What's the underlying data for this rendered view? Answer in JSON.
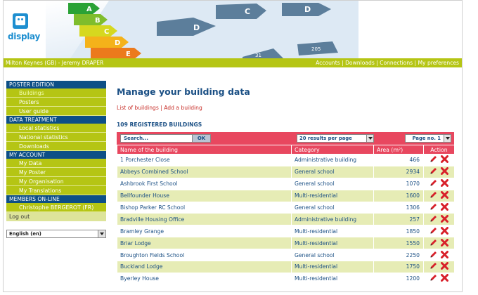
{
  "logo": {
    "word": "display"
  },
  "banner": {
    "scale_letters": [
      "A",
      "B",
      "C",
      "D",
      "E"
    ],
    "rating_tags": [
      "D",
      "C",
      "D"
    ],
    "tag_values": [
      "31",
      "205"
    ]
  },
  "topbar": {
    "user": "Milton Keynes (GB) - Jeremy DRAPER",
    "links": [
      "Accounts",
      "Downloads",
      "Connections",
      "My preferences"
    ],
    "separator": " | "
  },
  "sidebar": {
    "sections": [
      {
        "title": "POSTER EDITION",
        "items": [
          "Buildings",
          "Posters",
          "User guide"
        ]
      },
      {
        "title": "DATA TREATMENT",
        "items": [
          "Local statistics",
          "National statistics",
          "Downloads"
        ]
      },
      {
        "title": "MY ACCOUNT",
        "items": [
          "My Data",
          "My Poster",
          "My Organisation",
          "My Translations"
        ]
      },
      {
        "title": "MEMBERS ON-LINE",
        "items": [
          "Christophe BERGEROT (FR)"
        ]
      }
    ],
    "active_item": "Buildings",
    "logout": "Log out",
    "language": "English (en)"
  },
  "main": {
    "title": "Manage your building data",
    "links": [
      "List of buildings",
      "Add a building"
    ],
    "link_separator": " | ",
    "count": "109 REGISTERED BUILDINGS",
    "search": {
      "placeholder": "Search...",
      "button": "OK"
    },
    "per_page": "20 results per page",
    "page": "Page no. 1",
    "columns": [
      "Name of the building",
      "Category",
      "Area (m²)",
      "Action"
    ],
    "rows": [
      {
        "name": "1 Porchester Close",
        "category": "Administrative building",
        "area": "466"
      },
      {
        "name": "Abbeys Combined School",
        "category": "General school",
        "area": "2934"
      },
      {
        "name": "Ashbrook First School",
        "category": "General school",
        "area": "1070"
      },
      {
        "name": "Bellfounder House",
        "category": "Multi-residential",
        "area": "1600"
      },
      {
        "name": "Bishop Parker RC School",
        "category": "General school",
        "area": "1306"
      },
      {
        "name": "Bradville Housing Office",
        "category": "Administrative building",
        "area": "257"
      },
      {
        "name": "Bramley Grange",
        "category": "Multi-residential",
        "area": "1850"
      },
      {
        "name": "Briar Lodge",
        "category": "Multi-residential",
        "area": "1550"
      },
      {
        "name": "Broughton Fields School",
        "category": "General school",
        "area": "2250"
      },
      {
        "name": "Buckland Lodge",
        "category": "Multi-residential",
        "area": "1750"
      },
      {
        "name": "Byerley House",
        "category": "Multi-residential",
        "area": "1200"
      }
    ]
  },
  "colors": {
    "brand_green": "#b5c514",
    "nav_blue": "#0d4f86",
    "header_red": "#e8475f",
    "row_alt": "#e6ecb5",
    "title_blue": "#1a4f84"
  }
}
